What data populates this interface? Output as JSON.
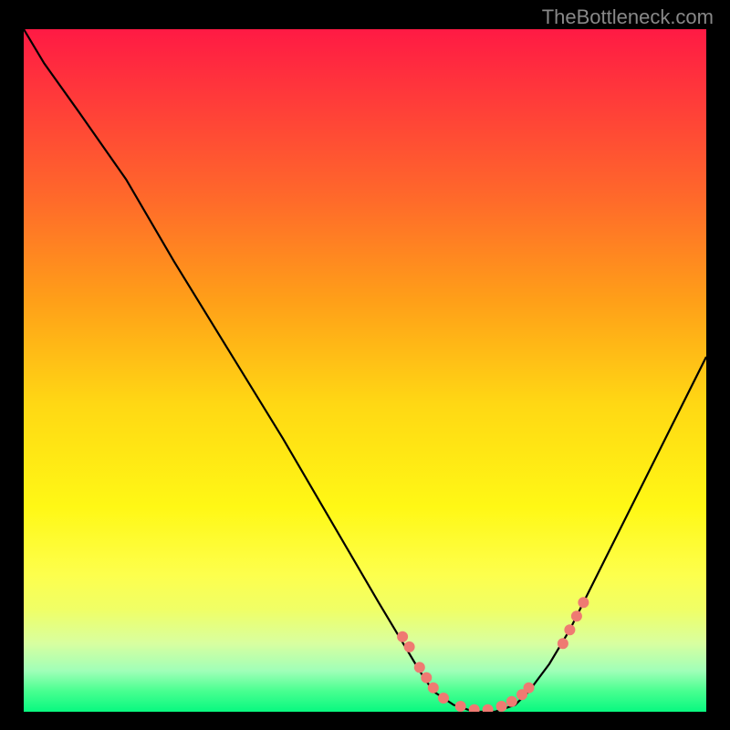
{
  "watermark": "TheBottleneck.com",
  "chart_data": {
    "type": "line",
    "title": "",
    "xlabel": "",
    "ylabel": "",
    "xlim": [
      0,
      100
    ],
    "ylim": [
      0,
      100
    ],
    "series": [
      {
        "name": "bottleneck-curve",
        "x": [
          0,
          3,
          8,
          15,
          22,
          30,
          38,
          45,
          52,
          55,
          58,
          60,
          63,
          66,
          69,
          72,
          74,
          77,
          80,
          85,
          90,
          95,
          100
        ],
        "y": [
          100,
          95,
          88,
          78,
          66,
          53,
          40,
          28,
          16,
          11,
          6,
          3,
          1,
          0,
          0,
          1,
          3,
          7,
          12,
          22,
          32,
          42,
          52
        ]
      }
    ],
    "scatter_points": {
      "name": "highlighted-dots",
      "x": [
        55.5,
        56.5,
        58,
        59,
        60,
        61.5,
        64,
        66,
        68,
        70,
        71.5,
        73,
        74,
        79,
        80,
        81,
        82
      ],
      "y": [
        11,
        9.5,
        6.5,
        5,
        3.5,
        2,
        0.8,
        0.3,
        0.3,
        0.8,
        1.5,
        2.5,
        3.5,
        10,
        12,
        14,
        16
      ]
    },
    "gradient_bands": [
      {
        "color": "#ff1a44",
        "stop": 0
      },
      {
        "color": "#ffd814",
        "stop": 55
      },
      {
        "color": "#08f880",
        "stop": 100
      }
    ]
  }
}
